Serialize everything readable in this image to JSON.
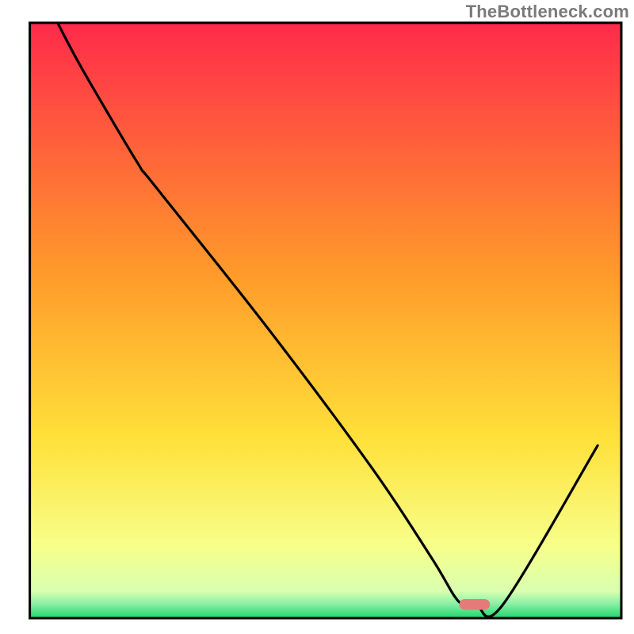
{
  "watermark": "TheBottleneck.com",
  "chart_data": {
    "type": "line",
    "title": "",
    "xlabel": "",
    "ylabel": "",
    "xlim": [
      0,
      100
    ],
    "ylim": [
      0,
      100
    ],
    "grid": false,
    "legend": false,
    "background_gradient": {
      "stops": [
        {
          "offset": 0,
          "color": "#ff2a4b"
        },
        {
          "offset": 0.42,
          "color": "#ff9a2a"
        },
        {
          "offset": 0.7,
          "color": "#ffe13a"
        },
        {
          "offset": 0.88,
          "color": "#f7ff8a"
        },
        {
          "offset": 0.955,
          "color": "#d9ffb0"
        },
        {
          "offset": 0.975,
          "color": "#8ef0a6"
        },
        {
          "offset": 1.0,
          "color": "#1fd66e"
        }
      ]
    },
    "series": [
      {
        "name": "black-curve",
        "type": "line",
        "color": "#000000",
        "x": [
          4.8,
          9.0,
          18.2,
          21.0,
          40.0,
          58.0,
          68.0,
          72.5,
          75.5,
          80.0,
          96.0
        ],
        "values": [
          99.8,
          92.0,
          76.5,
          72.8,
          49.0,
          25.0,
          10.0,
          2.8,
          2.1,
          2.3,
          29.0
        ],
        "note": "x and y are percentages of the plot area; y=0 at the bottom edge, y=100 at the top edge"
      },
      {
        "name": "red-marker",
        "type": "marker",
        "color": "#e67a7a",
        "x": 75.2,
        "y": 2.3,
        "width_pct": 5.2,
        "height_pct": 1.8,
        "shape": "rounded-bar-horizontal"
      }
    ],
    "frame": {
      "stroke": "#000000",
      "stroke_width": 3,
      "x0_pct": 4.7,
      "y0_pct": 3.6,
      "x1_pct": 98.0,
      "y1_pct": 97.5
    }
  }
}
